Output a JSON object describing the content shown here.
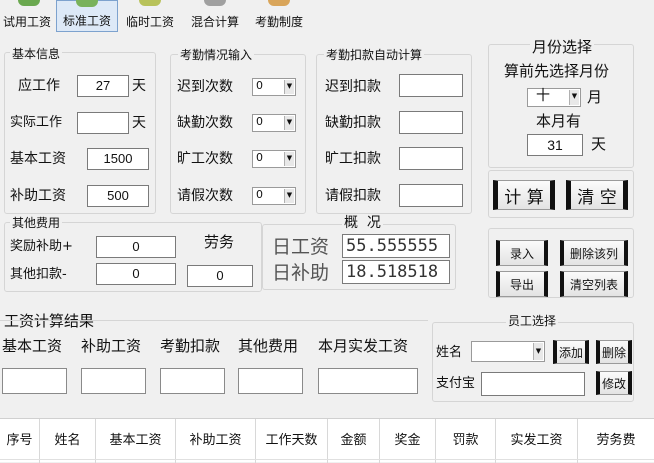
{
  "toolbar": {
    "items": [
      {
        "label": "试用工资",
        "icon": "trial-wage-icon"
      },
      {
        "label": "标准工资",
        "icon": "standard-wage-icon",
        "selected": true
      },
      {
        "label": "临时工资",
        "icon": "temp-wage-icon"
      },
      {
        "label": "混合计算",
        "icon": "mixed-calc-icon"
      },
      {
        "label": "考勤制度",
        "icon": "attendance-rule-icon"
      }
    ]
  },
  "basic": {
    "group": "基本信息",
    "should_work_label": "应工作",
    "should_work_value": "27",
    "should_work_unit": "天",
    "actual_work_label": "实际工作",
    "actual_work_value": "",
    "actual_work_unit": "天",
    "base_wage_label": "基本工资",
    "base_wage_value": "1500",
    "allowance_label": "补助工资",
    "allowance_value": "500"
  },
  "attendance": {
    "group": "考勤情况输入",
    "rows": [
      {
        "label": "迟到次数",
        "value": "0"
      },
      {
        "label": "缺勤次数",
        "value": "0"
      },
      {
        "label": "旷工次数",
        "value": "0"
      },
      {
        "label": "请假次数",
        "value": "0"
      }
    ]
  },
  "deduction": {
    "group": "考勤扣款自动计算",
    "rows": [
      {
        "label": "迟到扣款",
        "value": ""
      },
      {
        "label": "缺勤扣款",
        "value": ""
      },
      {
        "label": "旷工扣款",
        "value": ""
      },
      {
        "label": "请假扣款",
        "value": ""
      }
    ]
  },
  "month": {
    "group": "月份选择",
    "hint": "算前先选择月份",
    "value": "十",
    "unit": "月",
    "days_label": "本月有",
    "days_value": "31",
    "days_unit": "天"
  },
  "actions": {
    "calc": "计 算",
    "clear": "清 空"
  },
  "other": {
    "group": "其他费用",
    "bonus_label": "奖励补助+",
    "bonus_value": "0",
    "other_deduct_label": "其他扣款-",
    "other_deduct_value": "0",
    "labor_label": "劳务",
    "labor_value": "0"
  },
  "overview": {
    "group": "概  况",
    "daily_wage_label": "日工资",
    "daily_wage_value": "55.555555",
    "daily_allowance_label": "日补助",
    "daily_allowance_value": "18.518518"
  },
  "list_actions": {
    "enter": "录入",
    "delete": "删除该列",
    "export": "导出",
    "clear_list": "清空列表"
  },
  "result": {
    "group": "工资计算结果",
    "headers": [
      "基本工资",
      "补助工资",
      "考勤扣款",
      "其他费用",
      "本月实发工资"
    ]
  },
  "employee": {
    "group": "员工选择",
    "name_label": "姓名",
    "name_value": "",
    "add": "添加",
    "remove": "删除",
    "alipay_label": "支付宝",
    "alipay_value": "",
    "edit": "修改"
  },
  "table": {
    "columns": [
      "序号",
      "姓名",
      "基本工资",
      "补助工资",
      "工作天数",
      "金额",
      "奖金",
      "罚款",
      "实发工资",
      "劳务费"
    ]
  }
}
